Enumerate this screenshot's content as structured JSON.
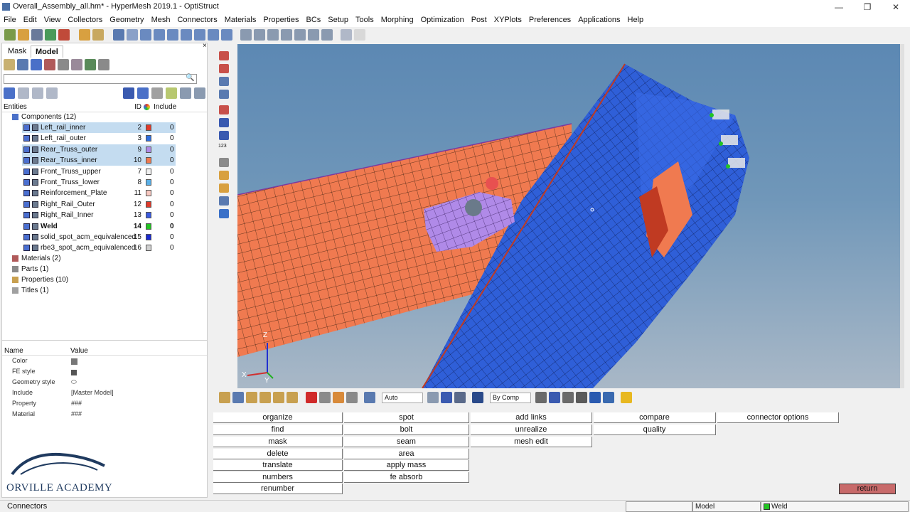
{
  "window": {
    "title": "Overall_Assembly_all.hm* - HyperMesh 2019.1 - OptiStruct",
    "min_glyph": "—",
    "max_glyph": "❐",
    "close_glyph": "✕"
  },
  "menu": [
    "File",
    "Edit",
    "View",
    "Collectors",
    "Geometry",
    "Mesh",
    "Connectors",
    "Materials",
    "Properties",
    "BCs",
    "Setup",
    "Tools",
    "Morphing",
    "Optimization",
    "Post",
    "XYPlots",
    "Preferences",
    "Applications",
    "Help"
  ],
  "tabs": {
    "mask": "Mask",
    "model": "Model"
  },
  "tree_header": {
    "entities": "Entities",
    "id": "ID",
    "include": "Include"
  },
  "components_header": "Components (12)",
  "components": [
    {
      "name": "Left_rail_inner",
      "id": "2",
      "color": "#e03a2a",
      "include": "0",
      "selected": true,
      "bold": false
    },
    {
      "name": "Left_rail_outer",
      "id": "3",
      "color": "#2f6fe0",
      "include": "0",
      "selected": false,
      "bold": false
    },
    {
      "name": "Rear_Truss_outer",
      "id": "9",
      "color": "#b08ae8",
      "include": "0",
      "selected": true,
      "bold": false
    },
    {
      "name": "Rear_Truss_inner",
      "id": "10",
      "color": "#f07a50",
      "include": "0",
      "selected": true,
      "bold": false
    },
    {
      "name": "Front_Truss_upper",
      "id": "7",
      "color": "#f0f0f0",
      "include": "0",
      "selected": false,
      "bold": false
    },
    {
      "name": "Front_Truss_lower",
      "id": "8",
      "color": "#5ab0e8",
      "include": "0",
      "selected": false,
      "bold": false
    },
    {
      "name": "Reinforcement_Plate",
      "id": "11",
      "color": "#f8c8c0",
      "include": "0",
      "selected": false,
      "bold": false
    },
    {
      "name": "Right_Rail_Outer",
      "id": "12",
      "color": "#e03a2a",
      "include": "0",
      "selected": false,
      "bold": false
    },
    {
      "name": "Right_Rail_Inner",
      "id": "13",
      "color": "#3a5ae0",
      "include": "0",
      "selected": false,
      "bold": false
    },
    {
      "name": "Weld",
      "id": "14",
      "color": "#22c422",
      "include": "0",
      "selected": false,
      "bold": true
    },
    {
      "name": "solid_spot_acm_equivalenced",
      "id": "15",
      "color": "#1a2ad0",
      "include": "0",
      "selected": false,
      "bold": false
    },
    {
      "name": "rbe3_spot_acm_equivalenced",
      "id": "16",
      "color": "#d0d0d0",
      "include": "0",
      "selected": false,
      "bold": false
    }
  ],
  "other_groups": [
    "Materials (2)",
    "Parts (1)",
    "Properties (10)",
    "Titles (1)"
  ],
  "properties_panel": {
    "name_header": "Name",
    "value_header": "Value",
    "rows": [
      {
        "name": "Color",
        "value": ""
      },
      {
        "name": "FE style",
        "value": ""
      },
      {
        "name": "Geometry style",
        "value": ""
      },
      {
        "name": "Include",
        "value": "[Master Model]"
      },
      {
        "name": "Property",
        "value": "###"
      },
      {
        "name": "Material",
        "value": "###"
      }
    ]
  },
  "logo": {
    "text": "ORVILLE ACADEMY"
  },
  "viewport": {
    "axis_z": "Z",
    "axis_x": "X",
    "axis_y": "Y",
    "label_123": "123"
  },
  "bottom_toolbar": {
    "auto_combo": "Auto",
    "bycomp_combo": "By Comp"
  },
  "panels": {
    "col1": [
      "organize",
      "find",
      "mask",
      "delete",
      "translate",
      "numbers",
      "renumber"
    ],
    "col2": [
      "spot",
      "bolt",
      "seam",
      "area",
      "apply mass",
      "fe absorb"
    ],
    "col3": [
      "add links",
      "unrealize",
      "mesh edit"
    ],
    "col4": [
      "compare",
      "quality"
    ],
    "col5": [
      "connector options"
    ],
    "return": "return"
  },
  "status": {
    "left": "Connectors",
    "model": "Model",
    "component": "Weld"
  },
  "colors": {
    "accent_blue": "#2f5fd8",
    "orange": "#f07a50",
    "purple": "#b08ae8",
    "return": "#c86a6a"
  }
}
